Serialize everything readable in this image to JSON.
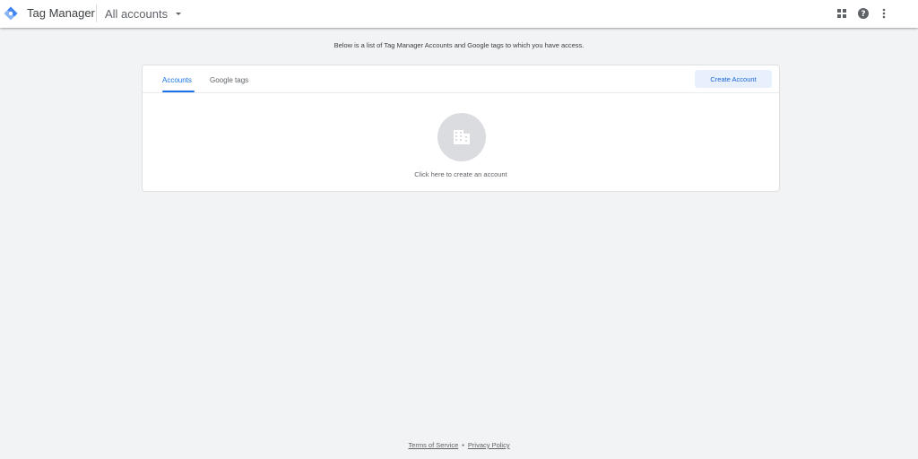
{
  "header": {
    "product_name": "Tag Manager",
    "account_selector": "All accounts",
    "icons": [
      "tag-manager-logo-icon",
      "apps-grid-icon",
      "help-icon",
      "more-vert-icon"
    ]
  },
  "intro": "Below is a list of Tag Manager Accounts and Google tags to which you have access.",
  "card": {
    "tabs": [
      {
        "label": "Accounts",
        "active": true
      },
      {
        "label": "Google tags",
        "active": false
      }
    ],
    "create_button": "Create Account",
    "empty_icon": "building-icon",
    "empty_text": "Click here to create an account"
  },
  "footer": {
    "terms": "Terms of Service",
    "separator": "•",
    "privacy": "Privacy Policy"
  },
  "colors": {
    "accent": "#1a73e8",
    "background": "#f1f3f4",
    "button_bg": "#e8f0fe"
  }
}
